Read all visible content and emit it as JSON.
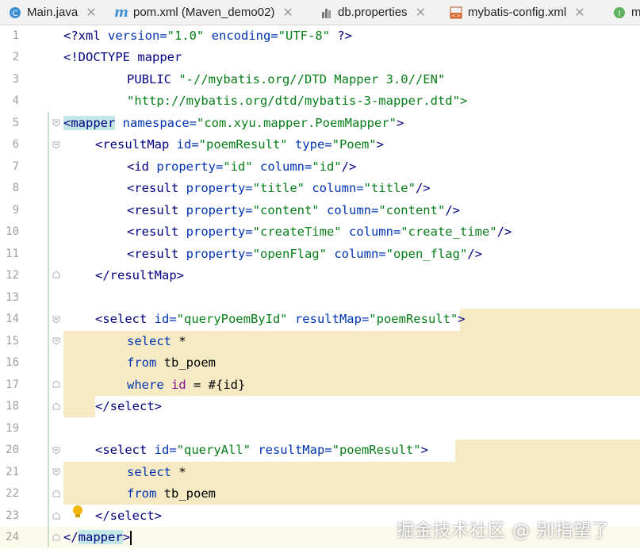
{
  "tabs": [
    {
      "label": "Main.java",
      "icon": "java-class-icon"
    },
    {
      "label": "pom.xml (Maven_demo02)",
      "icon": "maven-icon"
    },
    {
      "label": "db.properties",
      "icon": "properties-file-icon"
    },
    {
      "label": "mybatis-config.xml",
      "icon": "xml-file-icon"
    },
    {
      "label": "m",
      "icon": "interface-icon"
    }
  ],
  "line_numbers": [
    "1",
    "2",
    "3",
    "4",
    "5",
    "6",
    "7",
    "8",
    "9",
    "10",
    "11",
    "12",
    "13",
    "14",
    "15",
    "16",
    "17",
    "18",
    "19",
    "20",
    "21",
    "22",
    "23",
    "24"
  ],
  "code": {
    "l1": {
      "a": "<?",
      "b": "xml ",
      "c": "version=",
      "d": "\"1.0\"",
      "e": " encoding=",
      "f": "\"UTF-8\"",
      "g": " ?>"
    },
    "l2": {
      "a": "<!DOCTYPE mapper"
    },
    "l3": {
      "a": "PUBLIC ",
      "b": "\"-//mybatis.org//DTD Mapper 3.0//EN\""
    },
    "l4": {
      "a": "\"http://mybatis.org/dtd/mybatis-3-mapper.dtd\">"
    },
    "l5": {
      "a": "<",
      "b": "mapper",
      "c": " namespace=",
      "d": "\"com.xyu.mapper.PoemMapper\"",
      "e": ">"
    },
    "l6": {
      "a": "<resultMap ",
      "b": "id=",
      "c": "\"poemResult\"",
      "d": " type=",
      "e": "\"Poem\"",
      "f": ">"
    },
    "l7": {
      "a": "<id ",
      "b": "property=",
      "c": "\"id\"",
      "d": " column=",
      "e": "\"id\"",
      "f": "/>"
    },
    "l8": {
      "a": "<result ",
      "b": "property=",
      "c": "\"title\"",
      "d": " column=",
      "e": "\"title\"",
      "f": "/>"
    },
    "l9": {
      "a": "<result ",
      "b": "property=",
      "c": "\"content\"",
      "d": " column=",
      "e": "\"content\"",
      "f": "/>"
    },
    "l10": {
      "a": "<result ",
      "b": "property=",
      "c": "\"createTime\"",
      "d": " column=",
      "e": "\"create_time\"",
      "f": "/>"
    },
    "l11": {
      "a": "<result ",
      "b": "property=",
      "c": "\"openFlag\"",
      "d": " column=",
      "e": "\"open_flag\"",
      "f": "/>"
    },
    "l12": {
      "a": "</resultMap>"
    },
    "l14": {
      "a": "<select ",
      "b": "id=",
      "c": "\"queryPoemById\"",
      "d": " resultMap=",
      "e": "\"poemResult\"",
      "f": ">"
    },
    "l15": {
      "a": "select ",
      "b": "*"
    },
    "l16": {
      "a": "from ",
      "b": "tb_poem"
    },
    "l17": {
      "a": "where ",
      "b": "id",
      "c": " = #{id}"
    },
    "l18": {
      "a": "</select>"
    },
    "l20": {
      "a": "<select ",
      "b": "id=",
      "c": "\"queryAll\"",
      "d": " resultMap=",
      "e": "\"poemResult\"",
      "f": ">"
    },
    "l21": {
      "a": "select ",
      "b": "*"
    },
    "l22": {
      "a": "from ",
      "b": "tb_poem"
    },
    "l23": {
      "a": "</select>"
    },
    "l24": {
      "a": "</",
      "b": "mapper",
      ">": ">",
      "c": ">"
    }
  },
  "watermark": "掘金技术社区 @ 别指望了",
  "colors": {
    "tag": "#000080",
    "attr": "#0033b3",
    "value": "#067d17",
    "highlight": "#f5eac4",
    "match": "#c3e6e6"
  }
}
